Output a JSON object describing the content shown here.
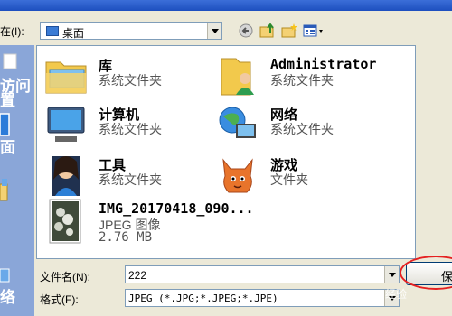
{
  "look_in": {
    "label": "在(I):",
    "value": "桌面"
  },
  "places": [
    "访问",
    "置",
    "面",
    "络"
  ],
  "files": [
    {
      "name": "库",
      "type": "系统文件夹",
      "icon": "library-icon"
    },
    {
      "name": "Administrator",
      "type": "系统文件夹",
      "icon": "user-folder-icon"
    },
    {
      "name": "计算机",
      "type": "系统文件夹",
      "icon": "computer-icon"
    },
    {
      "name": "网络",
      "type": "系统文件夹",
      "icon": "network-icon"
    },
    {
      "name": "工具",
      "type": "系统文件夹",
      "icon": "tools-folder-icon"
    },
    {
      "name": "游戏",
      "type": "文件夹",
      "icon": "games-folder-icon"
    },
    {
      "name": "IMG_20170418_090...",
      "type": "JPEG 图像",
      "size": "2.76 MB",
      "icon": "image-thumbnail-icon"
    }
  ],
  "filename": {
    "label": "文件名(N):",
    "value": "222"
  },
  "filetype": {
    "label": "格式(F):",
    "value": "JPEG (*.JPG;*.JPEG;*.JPE)"
  },
  "save_button": "保",
  "watermark": "Baidu 经验"
}
